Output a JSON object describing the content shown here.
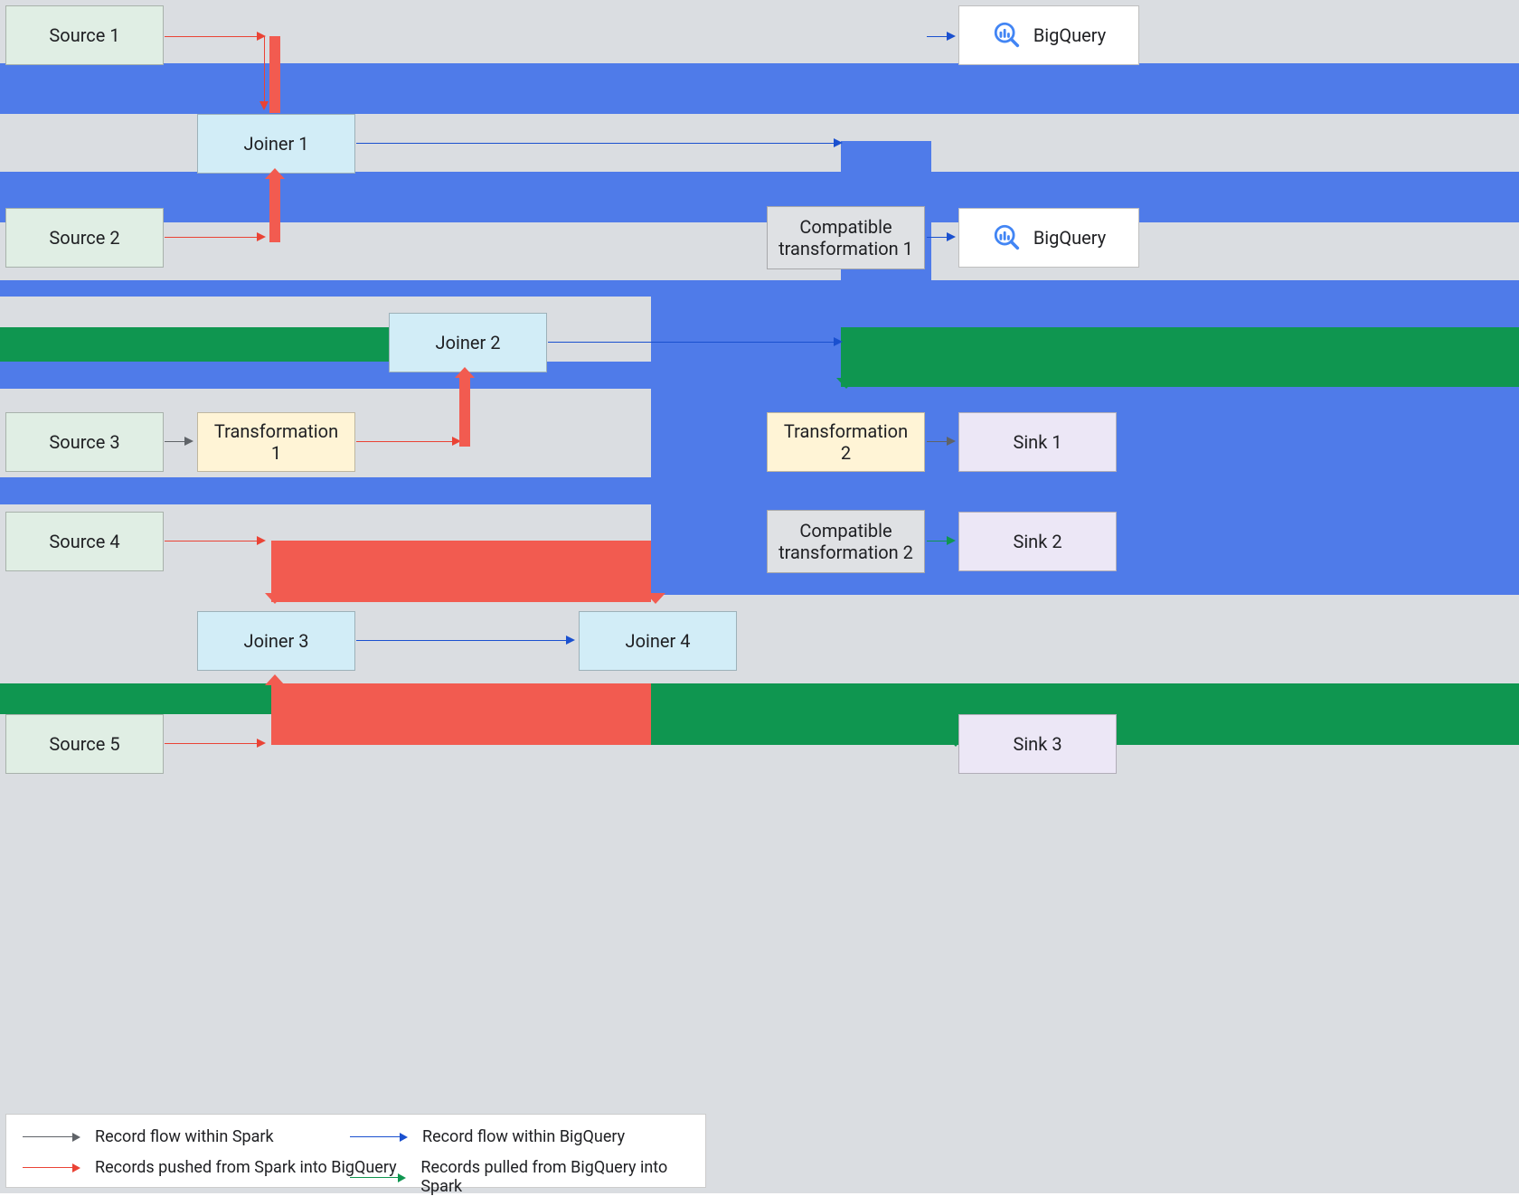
{
  "nodes": {
    "source1": "Source 1",
    "source2": "Source 2",
    "source3": "Source 3",
    "source4": "Source 4",
    "source5": "Source 5",
    "joiner1": "Joiner 1",
    "joiner2": "Joiner 2",
    "joiner3": "Joiner 3",
    "joiner4": "Joiner 4",
    "transformation1": "Transformation 1",
    "transformation2": "Transformation 2",
    "compatible1": "Compatible transformation 1",
    "compatible2": "Compatible transformation 2",
    "sink1": "Sink 1",
    "sink2": "Sink 2",
    "sink3": "Sink 3",
    "bigquery": "BigQuery"
  },
  "legend": {
    "within_spark": "Record flow within Spark",
    "within_bigquery": "Record flow within BigQuery",
    "pushed": "Records pushed from Spark into BigQuery",
    "pulled": "Records pulled from BigQuery into Spark"
  },
  "icons": {
    "bigquery": "bigquery-icon"
  },
  "colors": {
    "blue_band": "#4f7be9",
    "green_band": "#0f9650",
    "red_band": "#f25b50",
    "spark_arrow": "#5f6368",
    "bigquery_arrow": "#1a50cf",
    "push_arrow": "#ea4335",
    "pull_arrow": "#0f9650"
  }
}
